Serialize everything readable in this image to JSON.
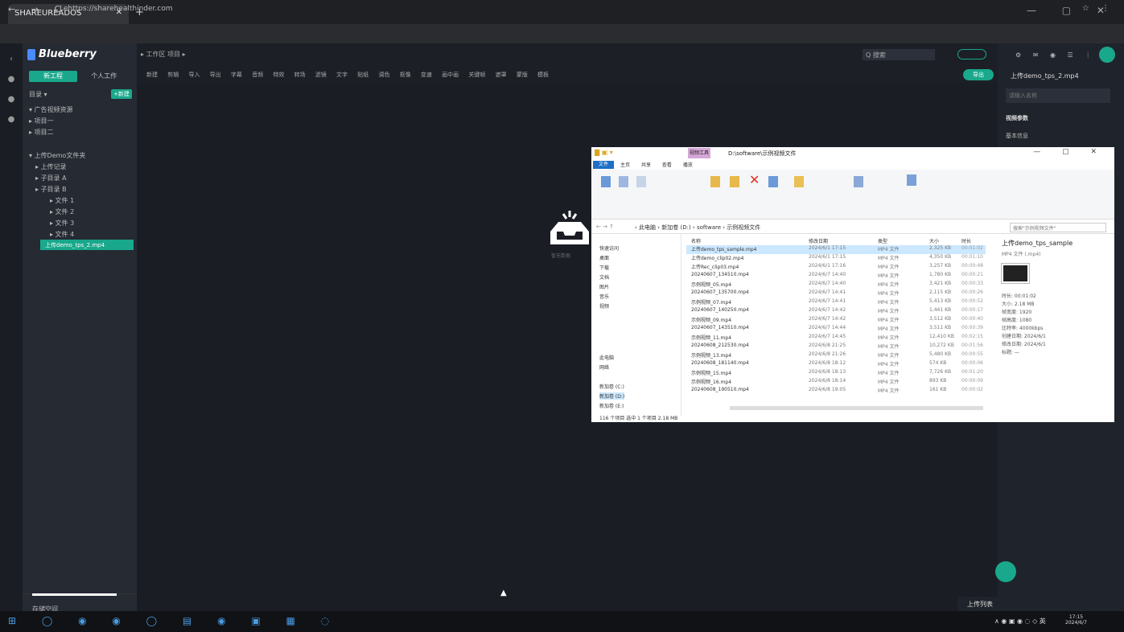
{
  "browser": {
    "tab_title": "SHAREUREADOS",
    "url": "Lehttps://sharehealthinder.com",
    "nav_buttons": "← → C",
    "new_tab": "+",
    "window_controls": "— ▢ ✕",
    "right_icons": "☆ ⋮"
  },
  "app": {
    "logo": "Blueberry",
    "left_tabs": [
      "新工程",
      "个人工作"
    ],
    "tools_label": "目录 ▾",
    "new_button": "+新建",
    "tree": [
      "▾ 广告视频资源",
      "▸ 项目一",
      "▸ 项目二",
      "▾ 上传Demo文件夹",
      "▸ 上传记录",
      "▸ 子目录 A",
      "▸ 子目录 B",
      "▸ 文件 1",
      "▸ 文件 2",
      "▸ 文件 3",
      "▸ 文件 4"
    ],
    "selected_item": "上传demo_tps_2.mp4",
    "footer_label": "存储空间",
    "empty_text": "暂无数据"
  },
  "toolbar": {
    "row1": "▸ 工作区  项目  ▸",
    "row2": "新建 剪辑 导入 导出 字幕 音频 特效 转场 滤镜 文字 贴纸 调色 抠像 变速 画中画 关键帧 遮罩 蒙版 模板",
    "search_placeholder": "Q 搜索",
    "export_button": "导出"
  },
  "right_panel": {
    "icons": "⚙ ✉ ◉ ☰ ⋮",
    "title": "上传demo_tps_2.mp4",
    "input_placeholder": "请输入名称",
    "section1": "视频参数",
    "section2": "基本信息"
  },
  "explorer": {
    "ribbon_tab": "视频工具",
    "path_title": "D:\\software\\示例视频文件",
    "menu_file": "文件",
    "menu_items": [
      "主页",
      "共享",
      "查看",
      "播放"
    ],
    "address": "› 此电脑 › 新加卷 (D:) › software › 示例视频文件",
    "search_placeholder": "搜索\"示例视频文件\"",
    "nav_items": [
      "快速访问",
      "桌面",
      "下载",
      "文档",
      "图片",
      "音乐",
      "视频",
      "此电脑",
      "网络",
      "新加卷 (C:)",
      "新加卷 (D:)",
      "新加卷 (E:)"
    ],
    "columns": [
      "名称",
      "修改日期",
      "类型",
      "大小",
      "时长"
    ],
    "files": [
      [
        "上传demo_tps_sample.mp4",
        "2024/6/1 17:15",
        "MP4 文件",
        "2,325 KB",
        "00:01:02"
      ],
      [
        "上传demo_clip02.mp4",
        "2024/6/1 17:15",
        "MP4 文件",
        "4,350 KB",
        "00:01:10"
      ],
      [
        "上传Rec_clip03.mp4",
        "2024/6/1 17:16",
        "MP4 文件",
        "3,257 KB",
        "00:00:48"
      ],
      [
        "20240607_134510.mp4",
        "2024/6/7 14:40",
        "MP4 文件",
        "1,780 KB",
        "00:00:21"
      ],
      [
        "示例视频_05.mp4",
        "2024/6/7 14:40",
        "MP4 文件",
        "3,421 KB",
        "00:00:33"
      ],
      [
        "20240607_135700.mp4",
        "2024/6/7 14:41",
        "MP4 文件",
        "2,115 KB",
        "00:00:26"
      ],
      [
        "示例视频_07.mp4",
        "2024/6/7 14:41",
        "MP4 文件",
        "5,413 KB",
        "00:00:52"
      ],
      [
        "20240607_140250.mp4",
        "2024/6/7 14:42",
        "MP4 文件",
        "1,441 KB",
        "00:00:17"
      ],
      [
        "示例视频_09.mp4",
        "2024/6/7 14:42",
        "MP4 文件",
        "3,512 KB",
        "00:00:40"
      ],
      [
        "20240607_143510.mp4",
        "2024/6/7 14:44",
        "MP4 文件",
        "3,511 KB",
        "00:00:39"
      ],
      [
        "示例视频_11.mp4",
        "2024/6/7 14:45",
        "MP4 文件",
        "12,410 KB",
        "00:02:15"
      ],
      [
        "20240608_212530.mp4",
        "2024/6/8 21:25",
        "MP4 文件",
        "10,272 KB",
        "00:01:56"
      ],
      [
        "示例视频_13.mp4",
        "2024/6/8 21:26",
        "MP4 文件",
        "5,480 KB",
        "00:00:55"
      ],
      [
        "20240608_181140.mp4",
        "2024/6/8 18:12",
        "MP4 文件",
        "574 KB",
        "00:00:06"
      ],
      [
        "示例视频_15.mp4",
        "2024/6/8 18:13",
        "MP4 文件",
        "7,726 KB",
        "00:01:20"
      ],
      [
        "示例视频_16.mp4",
        "2024/6/8 18:14",
        "MP4 文件",
        "893 KB",
        "00:00:09"
      ],
      [
        "20240608_190510.mp4",
        "2024/6/8 19:05",
        "MP4 文件",
        "161 KB",
        "00:00:02"
      ]
    ],
    "status": "116 个项目   选中 1 个项目 2.18 MB",
    "preview_title": "上传demo_tps_sample",
    "preview_sub": "MP4 文件 (.mp4)",
    "preview_rows": [
      "时长:  00:01:02",
      "大小:  2.18 MB",
      "帧宽度:  1920",
      "帧高度:  1080",
      "比特率:  4000kbps",
      "创建日期:  2024/6/1",
      "修改日期:  2024/6/1",
      "标题:  —"
    ]
  },
  "notify": "上传列表",
  "taskbar": {
    "icons": "⊞ ◯ ◉ ◉ ◯ ▤ ◉ ▣ ▦ ◌",
    "tray": "∧ ◉ ▣ ◉ ◌ ◇ 英",
    "time": "17:15",
    "date": "2024/6/7"
  }
}
